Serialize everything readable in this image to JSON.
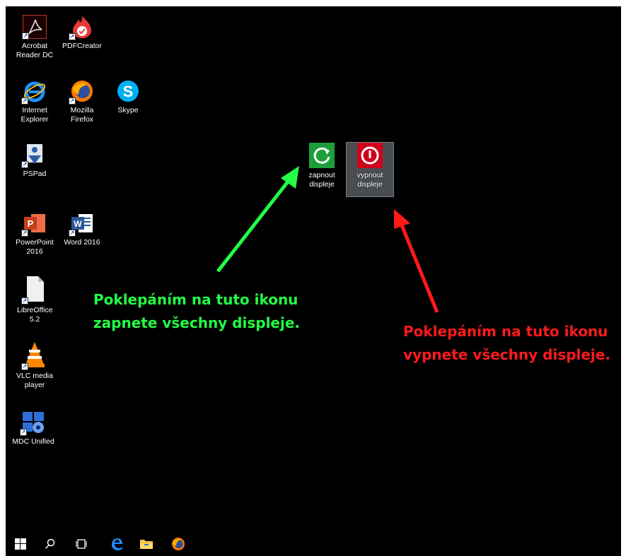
{
  "desktop": {
    "icons": [
      {
        "label": "Acrobat Reader DC",
        "icon": "acrobat-icon"
      },
      {
        "label": "PDFCreator",
        "icon": "pdfcreator-icon"
      },
      {
        "label": "Internet Explorer",
        "icon": "internet-explorer-icon"
      },
      {
        "label": "Mozilla Firefox",
        "icon": "firefox-icon"
      },
      {
        "label": "Skype",
        "icon": "skype-icon"
      },
      {
        "label": "PSPad",
        "icon": "pspad-icon"
      },
      {
        "label": "PowerPoint 2016",
        "icon": "powerpoint-icon"
      },
      {
        "label": "Word 2016",
        "icon": "word-icon"
      },
      {
        "label": "LibreOffice 5.2",
        "icon": "libreoffice-icon"
      },
      {
        "label": "VLC media player",
        "icon": "vlc-icon"
      },
      {
        "label": "MDC Unified",
        "icon": "mdc-unified-icon"
      },
      {
        "label": "zapnout displeje",
        "icon": "power-on-icon"
      },
      {
        "label": "vypnout displeje",
        "icon": "power-off-icon"
      }
    ]
  },
  "annotations": {
    "green_text_line1": "Poklepáním na tuto ikonu",
    "green_text_line2": "zapnete všechny displeje.",
    "red_text_line1": "Poklepáním na tuto ikonu",
    "red_text_line2": "vypnete všechny displeje.",
    "green_color": "#22ff44",
    "red_color": "#ff1a1a"
  },
  "taskbar": {
    "items": [
      "start-icon",
      "search-icon",
      "task-view-icon",
      "edge-icon",
      "file-explorer-icon",
      "firefox-icon"
    ]
  }
}
